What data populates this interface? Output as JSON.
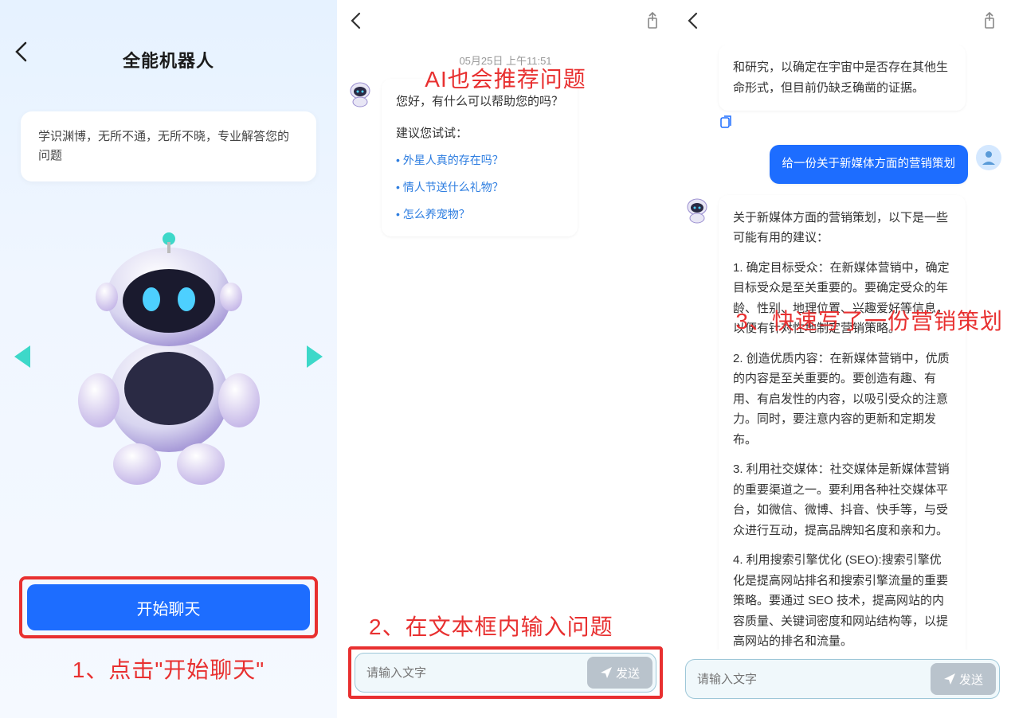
{
  "panel1": {
    "title": "全能机器人",
    "intro": "学识渊博，无所不通，无所不晓，专业解答您的问题",
    "start_button": "开始聊天",
    "annotation": "1、点击\"开始聊天\""
  },
  "panel2": {
    "timestamp": "05月25日  上午11:51",
    "annotation_top": "AI也会推荐问题",
    "bot_greeting": "您好，有什么可以帮助您的吗？",
    "suggest_title": "建议您试试：",
    "suggestions": [
      "外星人真的存在吗？",
      "情人节送什么礼物？",
      "怎么养宠物？"
    ],
    "input_placeholder": "请输入文字",
    "send_label": "发送",
    "annotation_bottom": "2、在文本框内输入问题"
  },
  "panel3": {
    "bot_partial": "和研究，以确定在宇宙中是否存在其他生命形式，但目前仍缺乏确凿的证据。",
    "user_msg": "给一份关于新媒体方面的营销策划",
    "answer_intro": "关于新媒体方面的营销策划，以下是一些可能有用的建议：",
    "answer_points": [
      "1. 确定目标受众：在新媒体营销中，确定目标受众是至关重要的。要确定受众的年龄、性别、地理位置、兴趣爱好等信息，以便有针对性地制定营销策略。",
      "2. 创造优质内容：在新媒体营销中，优质的内容是至关重要的。要创造有趣、有用、有启发性的内容，以吸引受众的注意力。同时，要注意内容的更新和定期发布。",
      "3. 利用社交媒体：社交媒体是新媒体营销的重要渠道之一。要利用各种社交媒体平台，如微信、微博、抖音、快手等，与受众进行互动，提高品牌知名度和亲和力。",
      "4. 利用搜索引擎优化 (SEO):搜索引擎优化是提高网站排名和搜索引擎流量的重要策略。要通过 SEO 技术，提高网站的内容质量、关键词密度和网站结构等，以提高网站的排名和流量。"
    ],
    "annotation": "3、快速写了一份营销策划",
    "input_placeholder": "请输入文字",
    "send_label": "发送"
  }
}
